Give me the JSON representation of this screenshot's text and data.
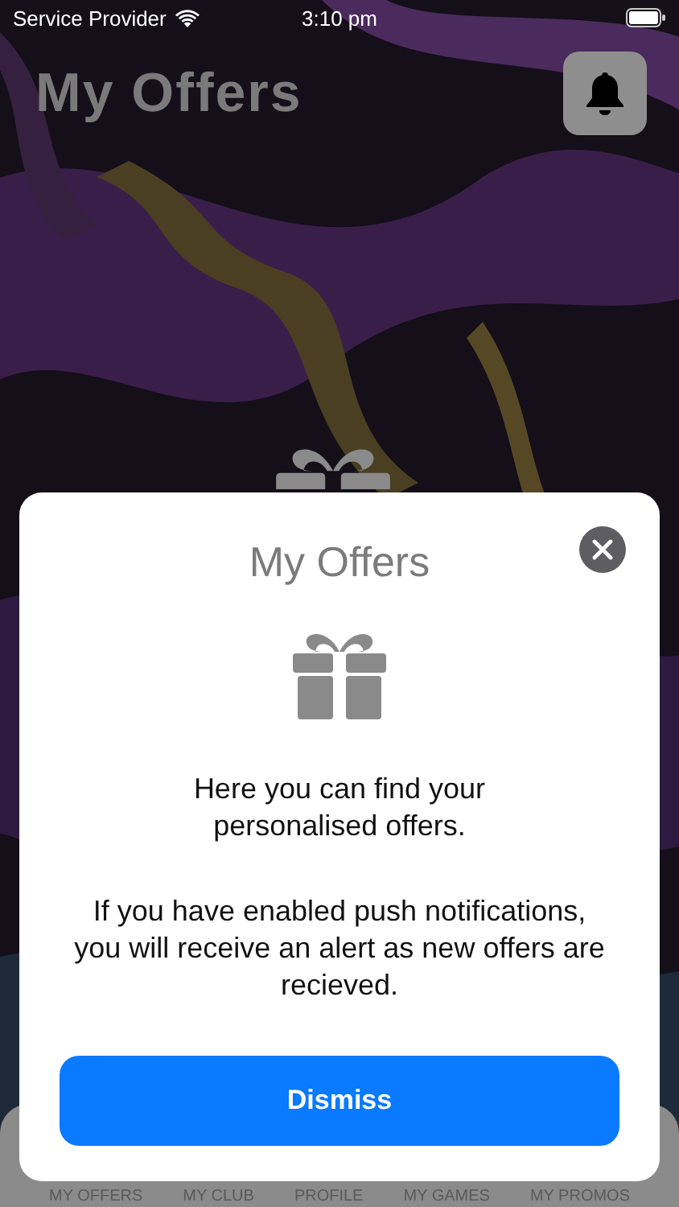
{
  "status_bar": {
    "carrier": "Service Provider",
    "time": "3:10 pm"
  },
  "header": {
    "title": "My Offers"
  },
  "tab_bar": {
    "tabs": [
      {
        "label": "MY OFFERS"
      },
      {
        "label": "MY CLUB"
      },
      {
        "label": "PROFILE"
      },
      {
        "label": "MY GAMES"
      },
      {
        "label": "MY PROMOS"
      }
    ]
  },
  "dialog": {
    "title": "My Offers",
    "message": "Here you can find your personalised offers.",
    "note": "If you have enabled push notifications, you will receive an alert as new offers are recieved.",
    "button": "Dismiss"
  }
}
